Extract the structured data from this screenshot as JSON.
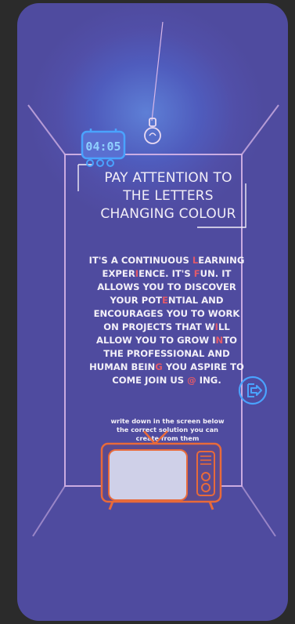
{
  "title_lines": [
    "PAY ATTENTION TO",
    "THE LETTERS",
    "CHANGING COLOUR"
  ],
  "timer_display": "04:05",
  "body": {
    "l1a": "IT'S A CONTINUOUS ",
    "l1b": "L",
    "l1c": "EARNING",
    "l2a": "EXPER",
    "l2b": "I",
    "l2c": "ENCE. IT'S ",
    "l2d": "F",
    "l2e": "UN. IT",
    "l3": "ALLOWS YOU TO DISCOVER",
    "l4a": "YOUR POT",
    "l4b": "E",
    "l4c": "NTIAL AND",
    "l5": "ENCOURAGES YOU TO WORK",
    "l6a": "ON PROJECTS THAT W",
    "l6b": "I",
    "l6c": "LL",
    "l7a": "ALLOW YOU TO GROW I",
    "l7b": "N",
    "l7c": "TO",
    "l8": "THE PROFESSIONAL AND",
    "l9a": "HUMAN BEIN",
    "l9b": "G",
    "l9c": " YOU ASPIRE TO",
    "l10a": "COME JOIN US ",
    "l10b": "@",
    "l10c": " ING."
  },
  "instructions": [
    "write down in the screen below",
    "the correct solution you can",
    "create from them"
  ],
  "icons": [
    "timer-icon",
    "light-bulb-icon",
    "exit-icon",
    "tv-icon"
  ],
  "colors": {
    "accent_blue": "#4aa3ff",
    "highlight_red": "#e05a6a",
    "tv_orange": "#e86a3a",
    "frame_pink": "#d9b7e6"
  }
}
